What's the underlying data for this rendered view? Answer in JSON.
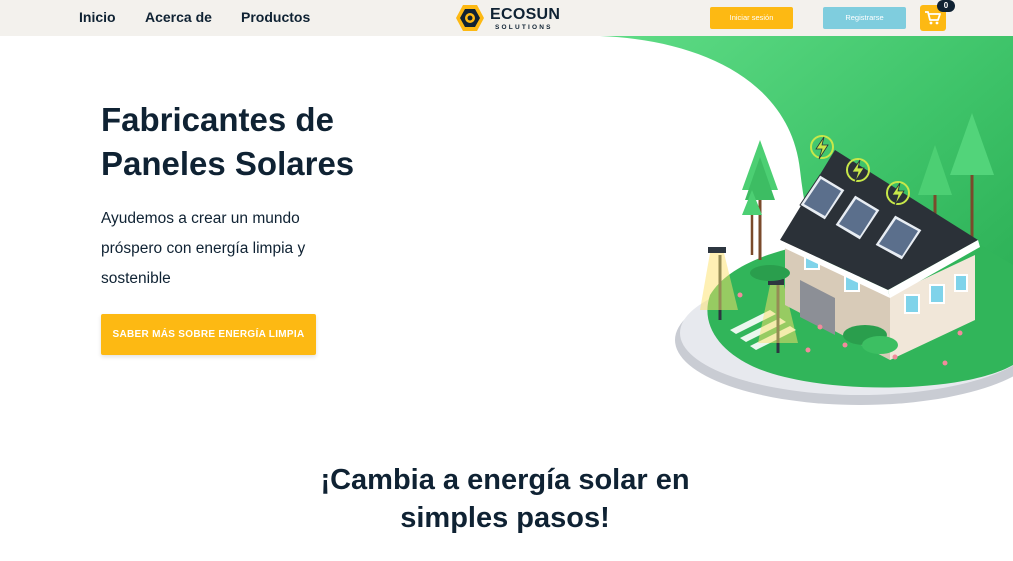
{
  "nav": {
    "links": [
      "Inicio",
      "Acerca de",
      "Productos"
    ]
  },
  "logo": {
    "name": "ECOSUN",
    "tagline": "SOLUTIONS"
  },
  "header": {
    "login_label": "Iniciar sesión",
    "register_label": "Registrarse",
    "cart_count": "0",
    "cart_icon": "shopping-cart-icon"
  },
  "hero": {
    "title": "Fabricantes de Paneles Solares",
    "subtitle": "Ayudemos a crear un mundo próspero con energía limpia y sostenible",
    "cta_label": "SABER MÁS SOBRE ENERGÍA LIMPIA",
    "illustration": "solar-house-illustration"
  },
  "steps": {
    "title": "¡Cambia a energía solar en simples pasos!"
  },
  "colors": {
    "primary_yellow": "#fdb913",
    "secondary_blue": "#7fcdde",
    "dark_text": "#0f2233",
    "hero_green": "#3dc56b",
    "navbar_bg": "#f3f1ed"
  }
}
